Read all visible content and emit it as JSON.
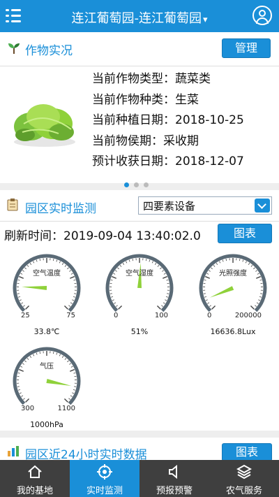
{
  "header": {
    "title": "连江葡萄园-连江葡萄园",
    "dropdown_icon": "chevron-down-icon",
    "menu_icon": "menu-icon",
    "user_icon": "user-icon"
  },
  "crop_section": {
    "title": "作物实况",
    "icon": "sprout-icon",
    "manage_label": "管理",
    "image": "lettuce-image",
    "info": [
      "当前作物类型：蔬菜类",
      "当前作物种类：生菜",
      "当前种植日期：2018-10-25",
      "当前物侯期：采收期",
      "预计收获日期：2018-12-07"
    ]
  },
  "monitor_section": {
    "title": "园区实时监测",
    "icon": "clipboard-icon",
    "device_select": "四要素设备",
    "refresh_text": "刷新时间：2019-09-04 13:40:02.0",
    "chart_label": "图表",
    "gauges": [
      {
        "label": "空气温度",
        "min": "25",
        "max": "75",
        "value": 33.8,
        "display": "33.8℃"
      },
      {
        "label": "空气湿度",
        "min": "0",
        "max": "100",
        "value": 51,
        "display": "51%"
      },
      {
        "label": "光照强度",
        "min": "0",
        "max": "200000",
        "value": 16636.8,
        "display": "16636.8Lux"
      },
      {
        "label": "气压",
        "min": "300",
        "max": "1100",
        "value": 1000,
        "display": "1000hPa"
      }
    ]
  },
  "history_section": {
    "title": "园区近24小时实时数据",
    "icon": "chart-icon",
    "chart_label": "图表"
  },
  "bottom_nav": [
    {
      "label": "我的基地",
      "icon": "home-icon",
      "active": false
    },
    {
      "label": "实时监测",
      "icon": "target-icon",
      "active": true
    },
    {
      "label": "预报预警",
      "icon": "speaker-icon",
      "active": false
    },
    {
      "label": "农气服务",
      "icon": "layers-icon",
      "active": false
    }
  ],
  "colors": {
    "primary": "#1a8fd8",
    "nav_bg": "#3f3f3f",
    "needle": "#8fd13a"
  }
}
